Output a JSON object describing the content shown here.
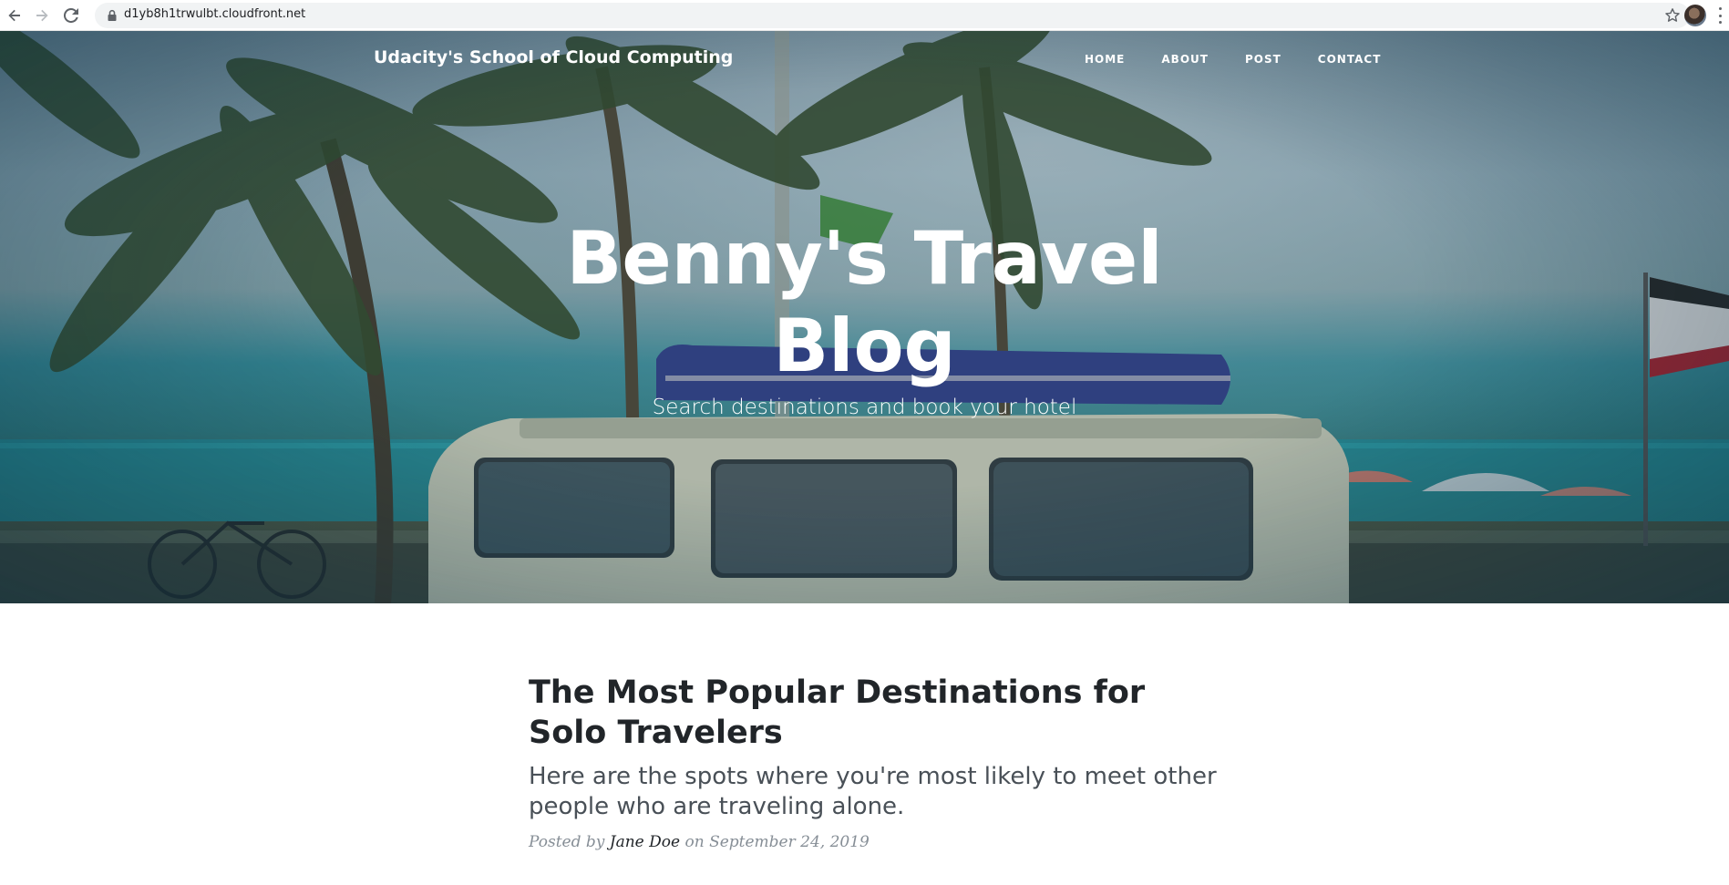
{
  "browser": {
    "url": "d1yb8h1trwulbt.cloudfront.net",
    "icons": [
      "back-arrow-icon",
      "forward-arrow-icon",
      "reload-icon",
      "lock-icon",
      "star-icon",
      "profile-avatar",
      "menu-kebab-icon"
    ]
  },
  "nav": {
    "brand": "Udacity's School of Cloud Computing",
    "items": [
      {
        "label": "HOME"
      },
      {
        "label": "ABOUT"
      },
      {
        "label": "POST"
      },
      {
        "label": "CONTACT"
      }
    ]
  },
  "hero": {
    "title_line1": "Benny's Travel",
    "title_line2": "Blog",
    "subtitle": "Search destinations and book your hotel"
  },
  "posts": [
    {
      "title": "The Most Popular Destinations for Solo Travelers",
      "subtitle": "Here are the spots where you're most likely to meet other people who are traveling alone.",
      "meta_prefix": "Posted by",
      "author": "Jane Doe",
      "meta_mid": "on",
      "date": "September 24, 2019"
    }
  ],
  "colors": {
    "heading": "#212529",
    "subheading": "#495057",
    "meta": "#868e96",
    "nav_text": "#ffffff"
  }
}
